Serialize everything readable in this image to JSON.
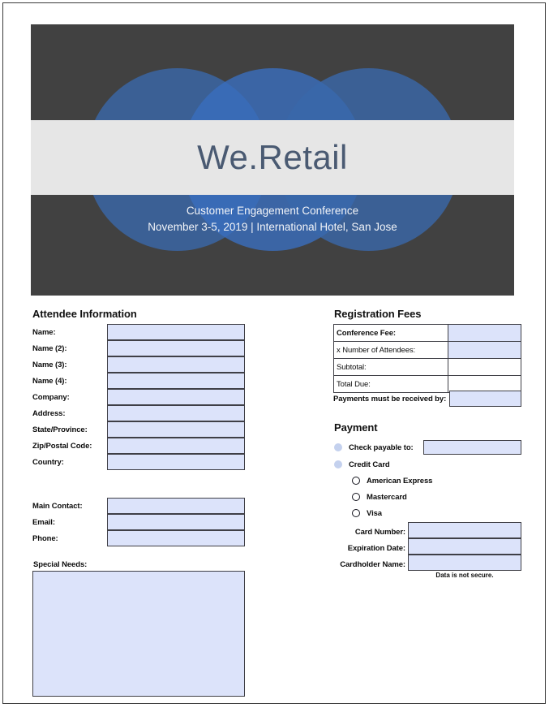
{
  "banner": {
    "title": "We.Retail",
    "subtitle_line1": "Customer Engagement Conference",
    "subtitle_line2": "November 3-5, 2019 | International Hotel, San Jose",
    "background_color": "#414141",
    "band_color": "#e6e6e6",
    "circle_color": "#3a68aa",
    "title_color": "#4a5a72"
  },
  "attendee": {
    "section_title": "Attendee Information",
    "fields": [
      {
        "label": "Name:",
        "value": ""
      },
      {
        "label": "Name (2):",
        "value": ""
      },
      {
        "label": "Name (3):",
        "value": ""
      },
      {
        "label": "Name (4):",
        "value": ""
      },
      {
        "label": "Company:",
        "value": ""
      },
      {
        "label": "Address:",
        "value": ""
      },
      {
        "label": "State/Province:",
        "value": ""
      },
      {
        "label": "Zip/Postal Code:",
        "value": ""
      },
      {
        "label": "Country:",
        "value": ""
      }
    ],
    "contact_fields": [
      {
        "label": "Main Contact:",
        "value": ""
      },
      {
        "label": "Email:",
        "value": ""
      },
      {
        "label": "Phone:",
        "value": ""
      }
    ],
    "special_needs_label": "Special Needs:",
    "special_needs_value": ""
  },
  "fees": {
    "section_title": "Registration Fees",
    "rows": [
      {
        "label": "Conference Fee:",
        "value": "",
        "bold": true,
        "fill": "blue"
      },
      {
        "label": "x Number of Attendees:",
        "value": "",
        "bold": false,
        "fill": "blue"
      },
      {
        "label": "Subtotal:",
        "value": "",
        "bold": false,
        "fill": "white"
      },
      {
        "label": "Total Due:",
        "value": "",
        "bold": false,
        "fill": "white"
      }
    ],
    "payments_due_label": "Payments must be received by:",
    "payments_due_value": ""
  },
  "payment": {
    "section_title": "Payment",
    "check_option_label": "Check payable to:",
    "check_payable_value": "",
    "credit_card_option_label": "Credit Card",
    "card_types": [
      {
        "label": "American Express",
        "selected": false
      },
      {
        "label": "Mastercard",
        "selected": false
      },
      {
        "label": "Visa",
        "selected": false
      }
    ],
    "card_fields": [
      {
        "label": "Card Number:",
        "value": ""
      },
      {
        "label": "Expiration Date:",
        "value": ""
      },
      {
        "label": "Cardholder Name:",
        "value": ""
      }
    ],
    "security_note": "Data is not secure."
  },
  "colors": {
    "field_fill": "#dce3fa",
    "field_border": "#3f3f46",
    "bullet_fill": "#c4d1ee",
    "page_border": "#3a3a3a"
  }
}
